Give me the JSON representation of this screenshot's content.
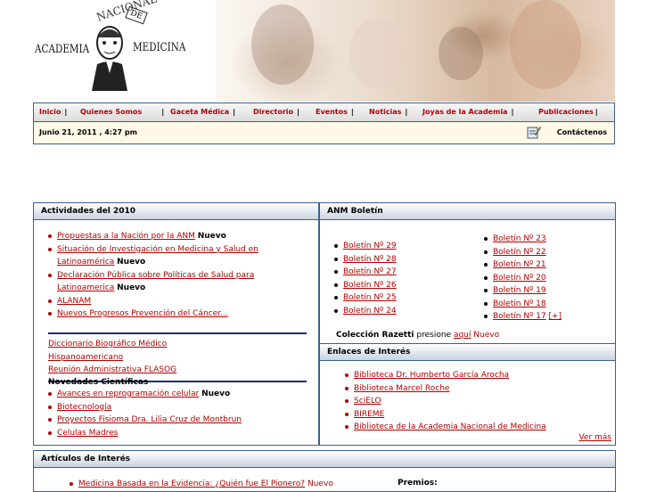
{
  "logo": {
    "nacional": "NACIONAL",
    "de": "DE",
    "academia": "ACADEMIA",
    "medicina": "MEDICINA"
  },
  "nav": [
    {
      "label": "Inicio"
    },
    {
      "label": "Quienes Somos"
    },
    {
      "label": "Gaceta Médica"
    },
    {
      "label": "Directorio"
    },
    {
      "label": "Eventos"
    },
    {
      "label": "Noticias"
    },
    {
      "label": "Joyas de la Academia"
    },
    {
      "label": "Publicaciones"
    }
  ],
  "nav_separator": "|",
  "datebar": {
    "date": "Junio 21, 2011 , 4:27 pm",
    "contact": "Contáctenos"
  },
  "left_panel": {
    "title": "Actividades del 2010",
    "items": [
      {
        "text": "Propuestas a la Nación por la ANM",
        "badge": "Nuevo"
      },
      {
        "text": "Situación de Investigación en Medicina y Salud en Latinoamérica",
        "badge": "Nuevo"
      },
      {
        "text": "Declaración Pública sobre Políticas de Salud para Latinoamerica",
        "badge": "Nuevo"
      },
      {
        "text": "ALANAM",
        "badge": ""
      },
      {
        "text": "Nuevos Progresos Prevención del Cáncer...",
        "badge": ""
      }
    ],
    "links": [
      "Diccionario Biográfico Médico",
      "Hispanoamericano",
      "Reunión Administrativa FLASOG"
    ],
    "novedades_title": "Novedades Científicas",
    "novedades": [
      {
        "text": "Avances en reprogramación celular",
        "badge": "Nuevo"
      },
      {
        "text": "Biotecnología",
        "badge": ""
      },
      {
        "text": "Proyectos Fisioma Dra. Lilia Cruz de Montbrun",
        "badge": ""
      },
      {
        "text": "Celulas Madres",
        "badge": ""
      }
    ]
  },
  "right_panel": {
    "title": "ANM Boletín",
    "boletin_left": [
      "Boletín Nº 29",
      "Boletín Nº 28",
      "Boletín Nº 27",
      "Boletín Nº 26",
      "Boletín Nº 25",
      "Boletín Nº 24"
    ],
    "boletin_right": [
      "Boletín Nº 23",
      " Boletín Nº 22",
      "Boletín Nº 21",
      "Boletín Nº 20",
      "Boletín Nº 19",
      "Boletín Nº 18",
      "Boletín Nº 17"
    ],
    "boletin_more": "[+]",
    "coleccion_label": "Colección Razetti",
    "coleccion_text": "presione",
    "coleccion_link": "aquí",
    "coleccion_badge": "Nuevo",
    "enlaces_title": "Enlaces de Interés",
    "enlaces": [
      "Biblioteca Dr. Humberto García Arocha",
      "Biblioteca Marcel Roche",
      "SciELO",
      "BIREME",
      "Biblioteca de la Academia Nacional de Medicina"
    ],
    "ver_mas": "Ver más"
  },
  "articulos": {
    "title": "Artículos de Interés",
    "first_item": "Medicina Basada en la Evidencia: ¿Quién fue El Pionero?",
    "first_badge": "Nuevo",
    "premios": "Premios:"
  }
}
